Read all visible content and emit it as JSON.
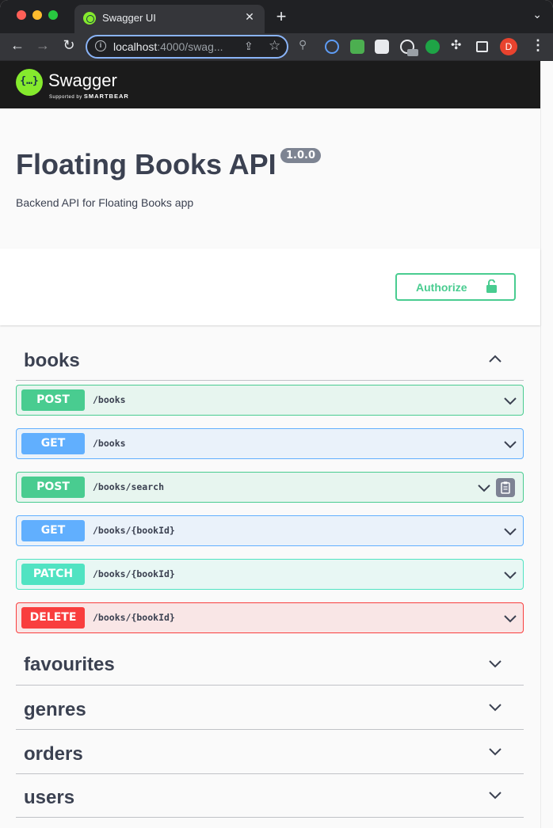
{
  "browser": {
    "tab_title": "Swagger UI",
    "tab_close": "✕",
    "new_tab": "+",
    "tab_menu": "⌄",
    "url_host": "localhost",
    "url_rest": ":4000/swag...",
    "avatar_letter": "D"
  },
  "topbar": {
    "logo_mark": "{…}",
    "logo_text": "Swagger",
    "logo_sub_prefix": "Supported by ",
    "logo_sub_brand": "SMARTBEAR"
  },
  "info": {
    "title": "Floating Books API",
    "version": "1.0.0",
    "description": "Backend API for Floating Books app"
  },
  "authorize": {
    "label": "Authorize"
  },
  "tags": [
    {
      "name": "books",
      "expanded": true,
      "operations": [
        {
          "method": "POST",
          "path": "/books"
        },
        {
          "method": "GET",
          "path": "/books"
        },
        {
          "method": "POST",
          "path": "/books/search",
          "copy_icon": "clipboard-icon"
        },
        {
          "method": "GET",
          "path": "/books/{bookId}"
        },
        {
          "method": "PATCH",
          "path": "/books/{bookId}"
        },
        {
          "method": "DELETE",
          "path": "/books/{bookId}"
        }
      ]
    },
    {
      "name": "favourites",
      "expanded": false
    },
    {
      "name": "genres",
      "expanded": false
    },
    {
      "name": "orders",
      "expanded": false
    },
    {
      "name": "users",
      "expanded": false
    }
  ],
  "colors": {
    "post": "#49cc90",
    "get": "#61affe",
    "patch": "#50e3c2",
    "delete": "#f93e3e",
    "text": "#3b4151"
  }
}
